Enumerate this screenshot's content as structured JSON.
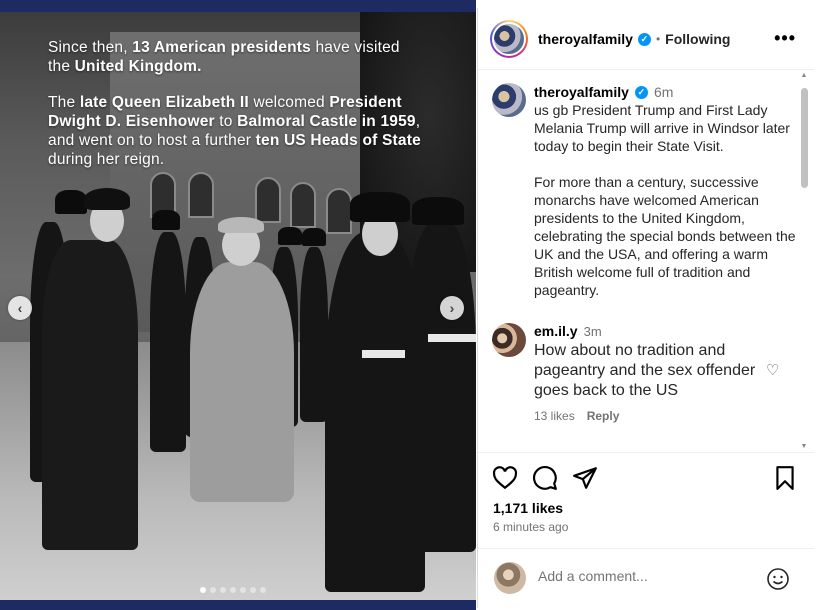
{
  "post": {
    "overlay_lines": [
      [
        {
          "t": "Since then, ",
          "b": false
        },
        {
          "t": "13 American presidents",
          "b": true
        },
        {
          "t": " have visited",
          "b": false
        }
      ],
      [
        {
          "t": "the ",
          "b": false
        },
        {
          "t": "United Kingdom.",
          "b": true
        }
      ],
      [
        {
          "t": "",
          "b": false
        }
      ],
      [
        {
          "t": "The ",
          "b": false
        },
        {
          "t": "late Queen Elizabeth II",
          "b": true
        },
        {
          "t": " welcomed ",
          "b": false
        },
        {
          "t": "President",
          "b": true
        }
      ],
      [
        {
          "t": "Dwight D. Eisenhower",
          "b": true
        },
        {
          "t": " to ",
          "b": false
        },
        {
          "t": "Balmoral Castle in 1959",
          "b": true
        },
        {
          "t": ",",
          "b": false
        }
      ],
      [
        {
          "t": "and went on to host a further ",
          "b": false
        },
        {
          "t": "ten US Heads of State",
          "b": true
        }
      ],
      [
        {
          "t": "during her reign.",
          "b": false
        }
      ]
    ],
    "carousel": {
      "count": 7,
      "active_index": 0
    }
  },
  "header": {
    "username": "theroyalfamily",
    "separator": "•",
    "follow_state": "Following",
    "more_icon": "more-horizontal-icon"
  },
  "caption": {
    "username": "theroyalfamily",
    "time": "6m",
    "paragraph1": "us gb President Trump and First Lady Melania Trump will arrive in Windsor later today to begin their State Visit.",
    "paragraph2": "For more than a century, successive monarchs have welcomed American presidents to the United Kingdom, celebrating the special bonds between the UK and the USA, and offering a warm British welcome full of tradition and pageantry."
  },
  "comment": {
    "username": "em.il.y",
    "time": "3m",
    "text": "How about no tradition and pageantry and the sex offender goes back to the US",
    "likes": "13 likes",
    "reply": "Reply"
  },
  "actions": {
    "likes": "1,171 likes",
    "posted": "6 minutes ago"
  },
  "add_comment": {
    "placeholder": "Add a comment..."
  },
  "colors": {
    "frame_blue": "#1e2b63",
    "verified_blue": "#0095f6",
    "muted_text": "#737373"
  }
}
